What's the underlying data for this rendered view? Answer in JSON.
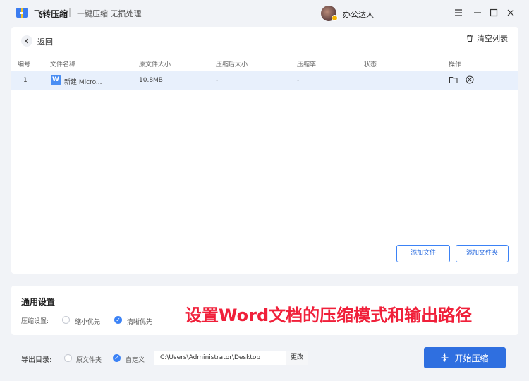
{
  "titlebar": {
    "app_title": "飞转压缩",
    "separator": "|",
    "subtitle": "一键压缩 无损处理",
    "username": "办公达人",
    "minimize": "—",
    "restore": "▢",
    "maximize": "☐",
    "close": "✕"
  },
  "panel": {
    "back_label": "返回",
    "clear_label": "清空列表",
    "columns": [
      "编号",
      "文件名称",
      "原文件大小",
      "压缩后大小",
      "压缩率",
      "状态",
      "操作"
    ],
    "rows": [
      {
        "index": "1",
        "name": "新建 Micro...",
        "original_size": "10.8MB",
        "compressed_size": "-",
        "ratio": "-",
        "status": "",
        "icon": "word-icon"
      }
    ],
    "add_file_label": "添加文件",
    "add_folder_label": "添加文件夹"
  },
  "settings": {
    "title": "通用设置",
    "compress_label": "压缩设置:",
    "option_small": "缩小优先",
    "option_clear": "清晰优先",
    "selected": "清晰优先"
  },
  "overlay_text": "设置Word文档的压缩模式和输出路径",
  "export": {
    "label": "导出目录:",
    "option_original": "原文件夹",
    "option_custom": "自定义",
    "selected": "自定义",
    "path": "C:\\Users\\Administrator\\Desktop",
    "change_label": "更改",
    "start_label": "开始压缩"
  },
  "colors": {
    "accent": "#2f6fe0",
    "row_highlight": "#e8f0fc",
    "overlay_red": "#f0203a"
  }
}
